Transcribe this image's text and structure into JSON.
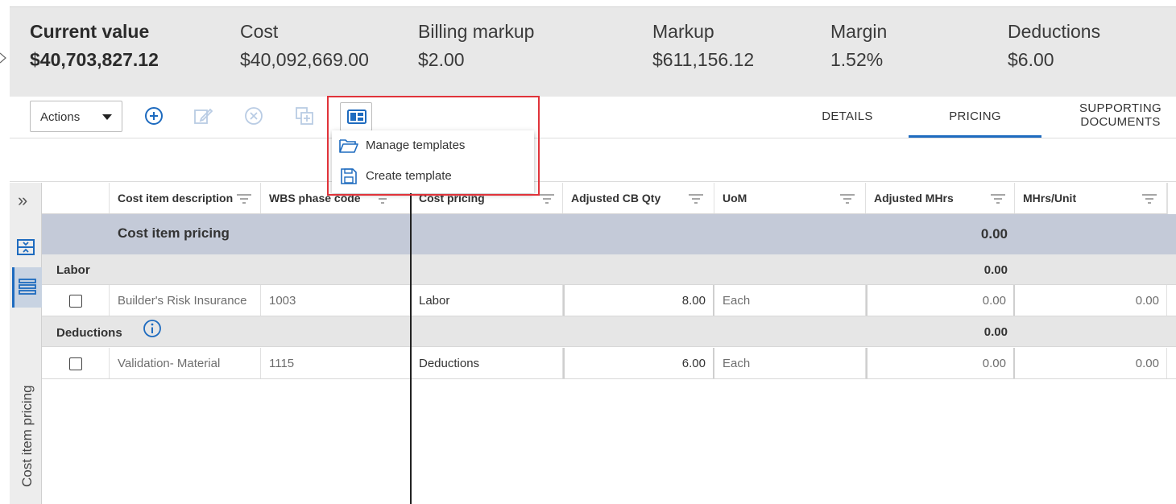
{
  "summary": {
    "current_value": {
      "label": "Current value",
      "value": "$40,703,827.12"
    },
    "cost": {
      "label": "Cost",
      "value": "$40,092,669.00"
    },
    "billing_markup": {
      "label": "Billing markup",
      "value": "$2.00"
    },
    "markup": {
      "label": "Markup",
      "value": "$611,156.12"
    },
    "margin": {
      "label": "Margin",
      "value": "1.52%"
    },
    "deductions": {
      "label": "Deductions",
      "value": "$6.00"
    }
  },
  "toolbar": {
    "actions_label": "Actions",
    "icons": [
      "add-icon",
      "edit-icon",
      "cancel-icon",
      "copy-add-icon",
      "template-icon"
    ]
  },
  "tabs": [
    {
      "label": "DETAILS",
      "active": false
    },
    {
      "label": "PRICING",
      "active": true
    },
    {
      "label_line1": "SUPPORTING",
      "label_line2": "DOCUMENTS",
      "active": false
    }
  ],
  "template_menu": {
    "items": [
      {
        "label": "Manage templates",
        "icon": "folder-open-icon"
      },
      {
        "label": "Create template",
        "icon": "save-icon"
      }
    ]
  },
  "side_panel": {
    "label": "Cost item pricing"
  },
  "grid": {
    "columns": [
      "Cost item description",
      "WBS phase code",
      "Cost pricing",
      "Adjusted CB Qty",
      "UoM",
      "Adjusted MHrs",
      "MHrs/Unit"
    ],
    "main_band": {
      "label": "Cost item pricing",
      "total": "0.00"
    },
    "groups": [
      {
        "label": "Labor",
        "total": "0.00",
        "rows": [
          {
            "description": "Builder's Risk Insurance",
            "wbs": "1003",
            "cost_pricing": "Labor",
            "adj_cb_qty": "8.00",
            "uom": "Each",
            "adj_mhrs": "0.00",
            "mhrs_unit": "0.00"
          }
        ]
      },
      {
        "label": "Deductions",
        "total": "0.00",
        "rows": [
          {
            "description": "Validation- Material",
            "wbs": "1115",
            "cost_pricing": "Deductions",
            "adj_cb_qty": "6.00",
            "uom": "Each",
            "adj_mhrs": "0.00",
            "mhrs_unit": "0.00"
          }
        ]
      }
    ]
  },
  "colors": {
    "accent": "#1e6bbf",
    "highlight_border": "#e0333a",
    "summary_bg": "#e8e8e8",
    "main_band_bg": "#c4cad8",
    "group_band_bg": "#e6e6e6"
  }
}
